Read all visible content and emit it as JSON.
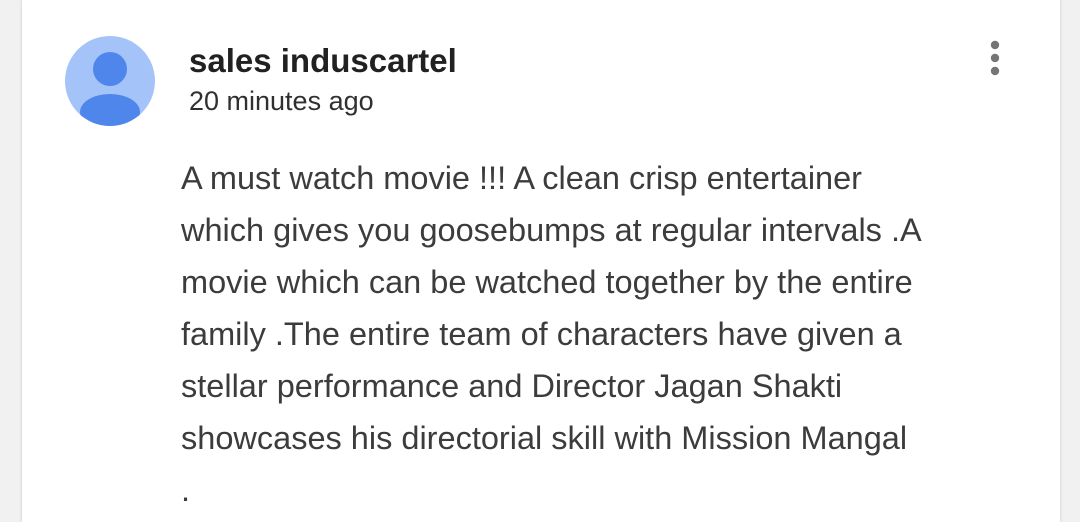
{
  "comment": {
    "author": "sales induscartel",
    "timestamp": "20 minutes ago",
    "text": "A must watch movie !!! A clean crisp entertainer\nwhich gives you goosebumps at regular intervals .A\nmovie which can be watched together by the entire\nfamily .The entire team of characters have given a\nstellar performance and Director Jagan Shakti\nshowcases his directorial skill with Mission Mangal\n.",
    "avatar_icon": "default-user-icon",
    "menu_icon": "more-vertical-icon"
  },
  "colors": {
    "avatar_bg": "#a4c3f9",
    "avatar_figure": "#4f86ec",
    "author_text": "#212121",
    "body_text": "#3c3c3c",
    "menu_dots": "#757575"
  }
}
